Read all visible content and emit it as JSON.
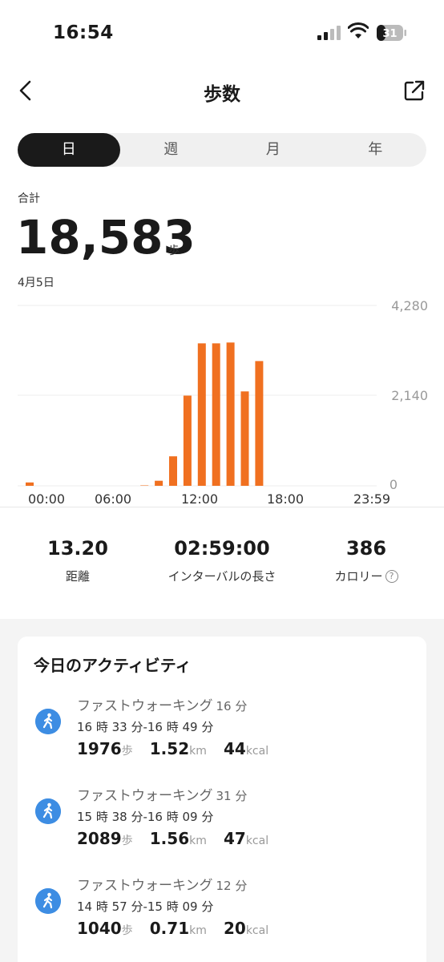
{
  "status_bar": {
    "time": "16:54",
    "battery": "31"
  },
  "header": {
    "title": "歩数",
    "back_icon": "chevron-left-icon",
    "share_icon": "share-external-icon"
  },
  "tabs": [
    {
      "label": "日",
      "active": true
    },
    {
      "label": "週",
      "active": false
    },
    {
      "label": "月",
      "active": false
    },
    {
      "label": "年",
      "active": false
    }
  ],
  "summary": {
    "label": "合計",
    "value": "18,583",
    "unit": "歩",
    "date": "4月5日"
  },
  "chart_data": {
    "type": "bar",
    "y_ticks": [
      "4,280",
      "2,140",
      "0"
    ],
    "ylim": [
      0,
      4280
    ],
    "x_ticks": [
      "00:00",
      "06:00",
      "12:00",
      "18:00",
      "23:59"
    ],
    "x": [
      0,
      8,
      9,
      10,
      11,
      12,
      13,
      14,
      15,
      16,
      17
    ],
    "values": [
      80,
      10,
      120,
      700,
      2140,
      3380,
      3380,
      3400,
      2240,
      2960,
      0
    ],
    "bar_color": "#f07020",
    "grid": true
  },
  "stats": [
    {
      "value": "13.20",
      "label": "距離"
    },
    {
      "value": "02:59:00",
      "label": "インターバルの長さ"
    },
    {
      "value": "386",
      "label": "カロリー",
      "help": "?"
    }
  ],
  "activities_section": {
    "title": "今日のアクティビティ",
    "items": [
      {
        "name": "ファストウォーキング",
        "duration": "16 分",
        "time_range": "16 時 33 分-16 時 49 分",
        "steps": "1976",
        "steps_unit": "歩",
        "distance": "1.52",
        "distance_unit": "km",
        "calories": "44",
        "calories_unit": "kcal",
        "icon": "walking-person-icon"
      },
      {
        "name": "ファストウォーキング",
        "duration": "31 分",
        "time_range": "15 時 38 分-16 時 09 分",
        "steps": "2089",
        "steps_unit": "歩",
        "distance": "1.56",
        "distance_unit": "km",
        "calories": "47",
        "calories_unit": "kcal",
        "icon": "walking-person-icon"
      },
      {
        "name": "ファストウォーキング",
        "duration": "12 分",
        "time_range": "14 時 57 分-15 時 09 分",
        "steps": "1040",
        "steps_unit": "歩",
        "distance": "0.71",
        "distance_unit": "km",
        "calories": "20",
        "calories_unit": "kcal",
        "icon": "walking-person-icon"
      }
    ]
  },
  "colors": {
    "accent": "#f07020",
    "activity_icon": "#3d8de3",
    "active_tab": "#1a1a1a"
  }
}
